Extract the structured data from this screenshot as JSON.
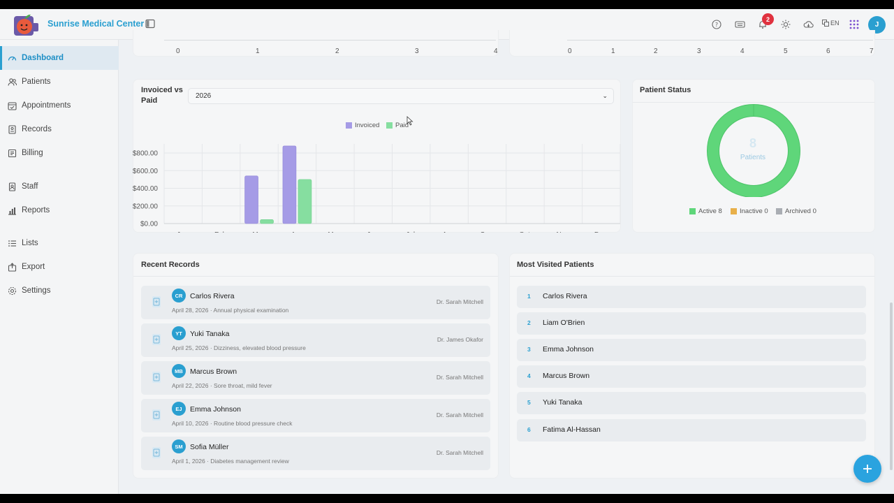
{
  "brand": {
    "name": "Sunrise Medical Center"
  },
  "header": {
    "notif_count": "2",
    "lang": "EN",
    "user_initial": "J"
  },
  "sidebar": {
    "items": [
      {
        "label": "Dashboard"
      },
      {
        "label": "Patients"
      },
      {
        "label": "Appointments"
      },
      {
        "label": "Records"
      },
      {
        "label": "Billing"
      },
      {
        "label": "Staff"
      },
      {
        "label": "Reports"
      },
      {
        "label": "Lists"
      },
      {
        "label": "Export"
      },
      {
        "label": "Settings"
      }
    ]
  },
  "top_axis_left": [
    "0",
    "1",
    "2",
    "3",
    "4"
  ],
  "top_axis_right": [
    "0",
    "1",
    "2",
    "3",
    "4",
    "5",
    "6",
    "7"
  ],
  "invoiced_card": {
    "title_line1": "Invoiced vs",
    "title_line2": "Paid",
    "year": "2026"
  },
  "chart_data": {
    "type": "bar",
    "categories": [
      "Jan",
      "Feb",
      "Mar",
      "Apr",
      "May",
      "Jun",
      "Jul",
      "Aug",
      "Sep",
      "Oct",
      "Nov",
      "Dec"
    ],
    "series": [
      {
        "name": "Invoiced",
        "color": "#a59be6",
        "values": [
          0,
          0,
          540,
          880,
          0,
          0,
          0,
          0,
          0,
          0,
          0,
          0
        ]
      },
      {
        "name": "Paid",
        "color": "#86dea0",
        "values": [
          0,
          0,
          45,
          500,
          0,
          0,
          0,
          0,
          0,
          0,
          0,
          0
        ]
      }
    ],
    "yticks": [
      "$0.00",
      "$200.00",
      "$400.00",
      "$600.00",
      "$800.00"
    ],
    "ylim": [
      0,
      800
    ],
    "legend": "top"
  },
  "patient_status": {
    "title": "Patient Status",
    "total": "8",
    "center_label": "Patients",
    "legend": [
      {
        "label": "Active",
        "count": "8",
        "color": "#5fd67a"
      },
      {
        "label": "Inactive",
        "count": "0",
        "color": "#e8b04a"
      },
      {
        "label": "Archived",
        "count": "0",
        "color": "#a9adb3"
      }
    ]
  },
  "recent_records": {
    "title": "Recent Records",
    "items": [
      {
        "initials": "CR",
        "name": "Carlos Rivera",
        "sub": "April 28, 2026 · Annual physical examination",
        "doctor": "Dr. Sarah Mitchell"
      },
      {
        "initials": "YT",
        "name": "Yuki Tanaka",
        "sub": "April 25, 2026 · Dizziness, elevated blood pressure",
        "doctor": "Dr. James Okafor"
      },
      {
        "initials": "MB",
        "name": "Marcus Brown",
        "sub": "April 22, 2026 · Sore throat, mild fever",
        "doctor": "Dr. Sarah Mitchell"
      },
      {
        "initials": "EJ",
        "name": "Emma Johnson",
        "sub": "April 10, 2026 · Routine blood pressure check",
        "doctor": "Dr. Sarah Mitchell"
      },
      {
        "initials": "SM",
        "name": "Sofia Müller",
        "sub": "April 1, 2026 · Diabetes management review",
        "doctor": "Dr. Sarah Mitchell"
      }
    ]
  },
  "most_visited": {
    "title": "Most Visited Patients",
    "items": [
      {
        "rank": "1",
        "name": "Carlos Rivera"
      },
      {
        "rank": "2",
        "name": "Liam O'Brien"
      },
      {
        "rank": "3",
        "name": "Emma Johnson"
      },
      {
        "rank": "4",
        "name": "Marcus Brown"
      },
      {
        "rank": "5",
        "name": "Yuki Tanaka"
      },
      {
        "rank": "6",
        "name": "Fatima Al-Hassan"
      }
    ]
  }
}
